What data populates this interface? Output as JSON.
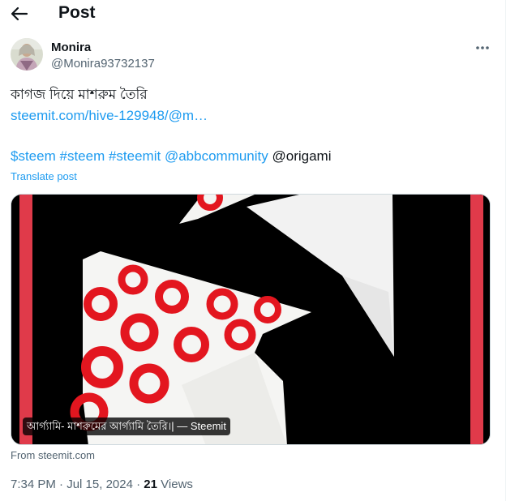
{
  "header": {
    "title": "Post",
    "back_icon": "arrow-left-icon"
  },
  "author": {
    "name": "Monira",
    "handle": "@Monira93732137",
    "avatar_icon": "avatar"
  },
  "post": {
    "text": "কাগজ দিয়ে মাশরুম তৈরি",
    "url": "steemit.com/hive-129948/@m…",
    "tags": [
      "$steem",
      "#steem",
      "#steemit",
      "@abbcommunity"
    ],
    "trailing_text": "@origami",
    "translate_label": "Translate post"
  },
  "card": {
    "caption": "আর্গ্যামি- মাশরুমের আর্গ্যামি তৈরি।| — Steemit",
    "source": "From steemit.com"
  },
  "meta": {
    "time": "7:34 PM",
    "separator": "·",
    "date": "Jul 15, 2024",
    "views_count": "21",
    "views_label": "Views"
  },
  "colors": {
    "link": "#1d9bf0",
    "muted": "#536471",
    "accent_red": "#e03a4a"
  }
}
